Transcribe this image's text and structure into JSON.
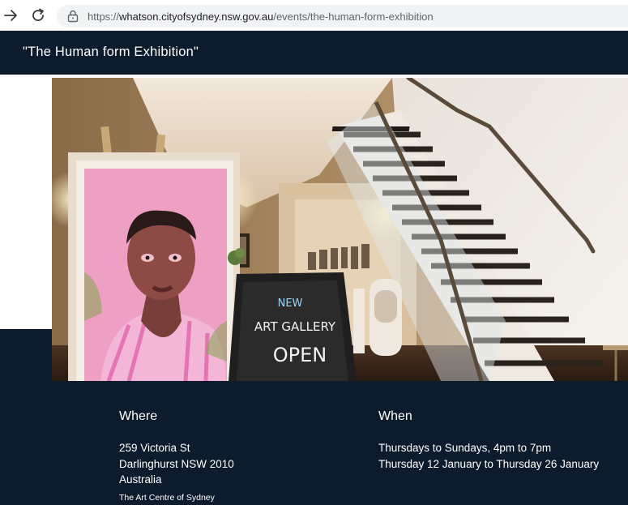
{
  "browser": {
    "url_prefix": "https://",
    "url_domain": "whatson.cityofsydney.nsw.gov.au",
    "url_path": "/events/the-human-form-exhibition",
    "icons": [
      "back-arrow-icon",
      "reload-icon",
      "lock-icon"
    ]
  },
  "header": {
    "title": "\"The Human form Exhibition\""
  },
  "photo": {
    "sign_lines": [
      "NEW",
      "ART GALLERY",
      "OPEN"
    ]
  },
  "where": {
    "heading": "Where",
    "address_line1": "259 Victoria St",
    "address_line2": "Darlinghurst NSW 2010",
    "address_line3": "Australia",
    "venue": "The Art Centre of Sydney"
  },
  "when": {
    "heading": "When",
    "schedule": "Thursdays to Sundays, 4pm to 7pm",
    "dates": "Thursday 12 January to Thursday 26 January"
  },
  "colors": {
    "header_bg": "#0c1c2c",
    "text": "#ffffff"
  }
}
